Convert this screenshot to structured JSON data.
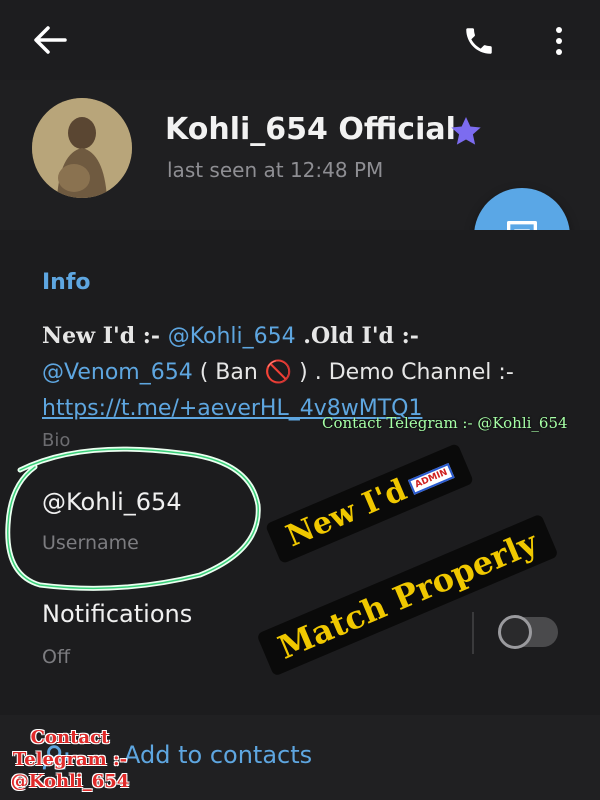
{
  "header": {
    "back_icon": "arrow-left-icon",
    "call_icon": "phone-icon",
    "more_icon": "more-vertical-icon"
  },
  "profile": {
    "name": "Kohli_654 Official",
    "status": "last seen at 12:48 PM",
    "star_color": "#7c6cf0"
  },
  "fab": {
    "icon": "message-icon",
    "color": "#5aa7e6"
  },
  "info": {
    "title": "Info",
    "bio_prefix": "New I'd :- ",
    "bio_handle1": "@Kohli_654",
    "bio_old": " .Old I'd :-",
    "bio_handle2": "@Venom_654",
    "bio_ban": " ( Ban 🚫 ) . Demo Channel :-",
    "bio_link": "https://t.me/+aeverHL_4v8wMTQ1",
    "bio_label": "Bio",
    "username": "@Kohli_654",
    "username_label": "Username",
    "notifications": "Notifications",
    "notifications_value": "Off"
  },
  "bottom": {
    "add_contacts": "Add to contacts"
  },
  "overlay": {
    "contact_top": "Contact Telegram :- @Kohli_654",
    "contact_bottom": "Contact Telegram :- @Kohli_654",
    "sticker1": "New I'd",
    "admin_badge": "ADMIN",
    "sticker2": "Match Properly"
  }
}
